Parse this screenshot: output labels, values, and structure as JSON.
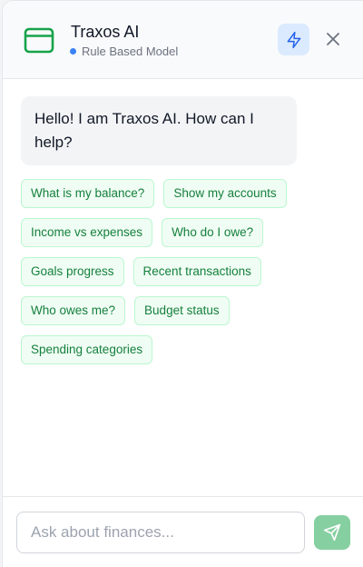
{
  "header": {
    "title": "Traxos AI",
    "subtitle": "Rule Based Model",
    "logo_icon": "browser-window-icon",
    "mode_icon": "lightning-bolt-icon",
    "close_icon": "close-icon",
    "colors": {
      "logo": "#16a34a",
      "status_dot": "#3b82f6",
      "mode_button_bg": "#dbeafe",
      "mode_icon": "#2563eb"
    }
  },
  "messages": [
    {
      "role": "assistant",
      "text": "Hello! I am Traxos AI. How can I help?"
    }
  ],
  "suggestions": [
    "What is my balance?",
    "Show my accounts",
    "Income vs expenses",
    "Who do I owe?",
    "Goals progress",
    "Recent transactions",
    "Who owes me?",
    "Budget status",
    "Spending categories"
  ],
  "composer": {
    "placeholder": "Ask about finances...",
    "value": "",
    "send_icon": "send-icon",
    "send_color": "#86cfa0"
  }
}
